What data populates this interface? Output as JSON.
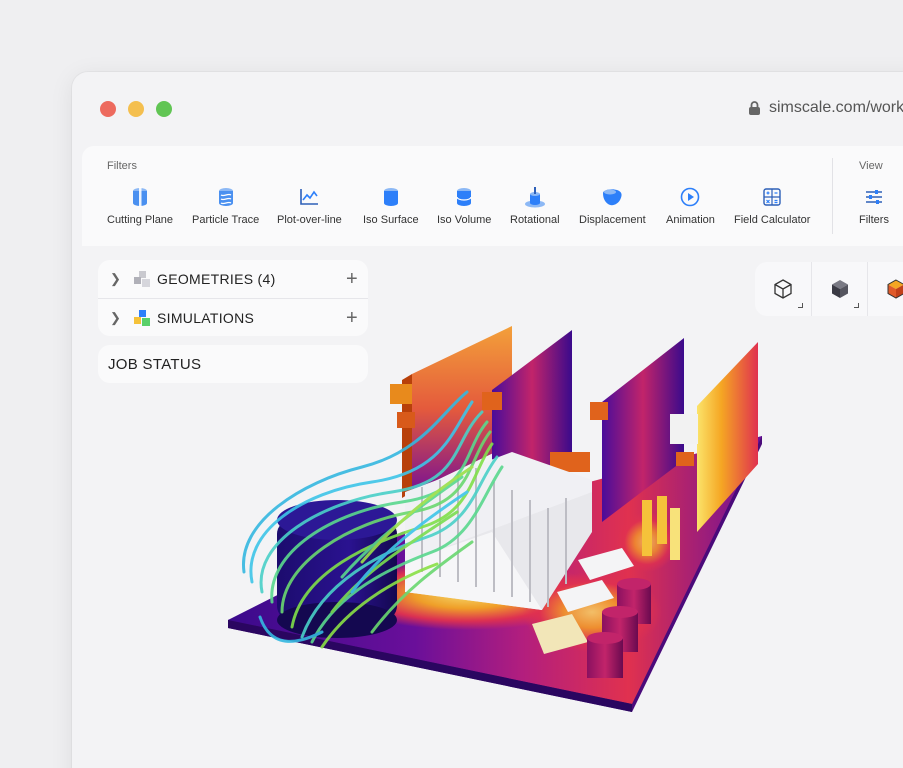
{
  "browser": {
    "url": "simscale.com/work"
  },
  "toolbar": {
    "filters_label": "Filters",
    "view_label": "View",
    "items": [
      {
        "label": "Cutting Plane",
        "icon": "cutting-plane-icon"
      },
      {
        "label": "Particle Trace",
        "icon": "particle-trace-icon"
      },
      {
        "label": "Plot-over-line",
        "icon": "plot-over-line-icon"
      },
      {
        "label": "Iso Surface",
        "icon": "iso-surface-icon"
      },
      {
        "label": "Iso Volume",
        "icon": "iso-volume-icon"
      },
      {
        "label": "Rotational",
        "icon": "rotational-icon"
      },
      {
        "label": "Displacement",
        "icon": "displacement-icon"
      },
      {
        "label": "Animation",
        "icon": "animation-icon"
      },
      {
        "label": "Field Calculator",
        "icon": "field-calculator-icon"
      }
    ],
    "view_items": [
      {
        "label": "Filters",
        "icon": "sliders-icon"
      }
    ]
  },
  "tree": {
    "geometries": "GEOMETRIES (4)",
    "simulations": "SIMULATIONS",
    "job_status": "JOB STATUS"
  },
  "colors": {
    "accent": "#2d7ff9",
    "heat_low": "#3a0a8c",
    "heat_mid": "#e0314f",
    "heat_high": "#fbe36a"
  }
}
